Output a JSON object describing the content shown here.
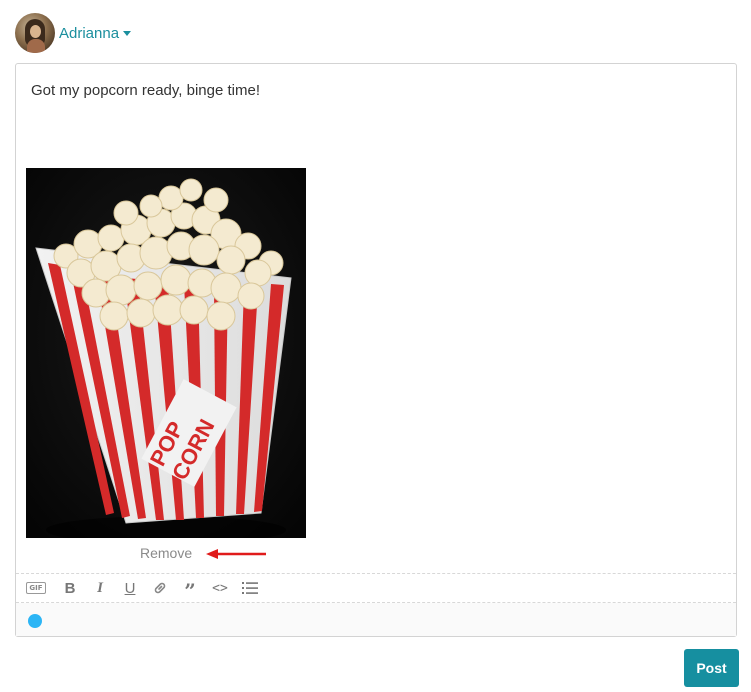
{
  "user": {
    "name": "Adrianna"
  },
  "composer": {
    "text": "Got my popcorn ready, binge time!",
    "remove_label": "Remove",
    "toolbar": {
      "gif_label": "GIF",
      "bold_label": "B",
      "italic_label": "I",
      "underline_label": "U",
      "quote_label": "”",
      "code_label": "<>"
    }
  },
  "actions": {
    "post_label": "Post"
  },
  "colors": {
    "accent": "#168fa0",
    "link": "#1b8f9e",
    "status_dot": "#2cb5f5",
    "arrow": "#e01b1b"
  }
}
